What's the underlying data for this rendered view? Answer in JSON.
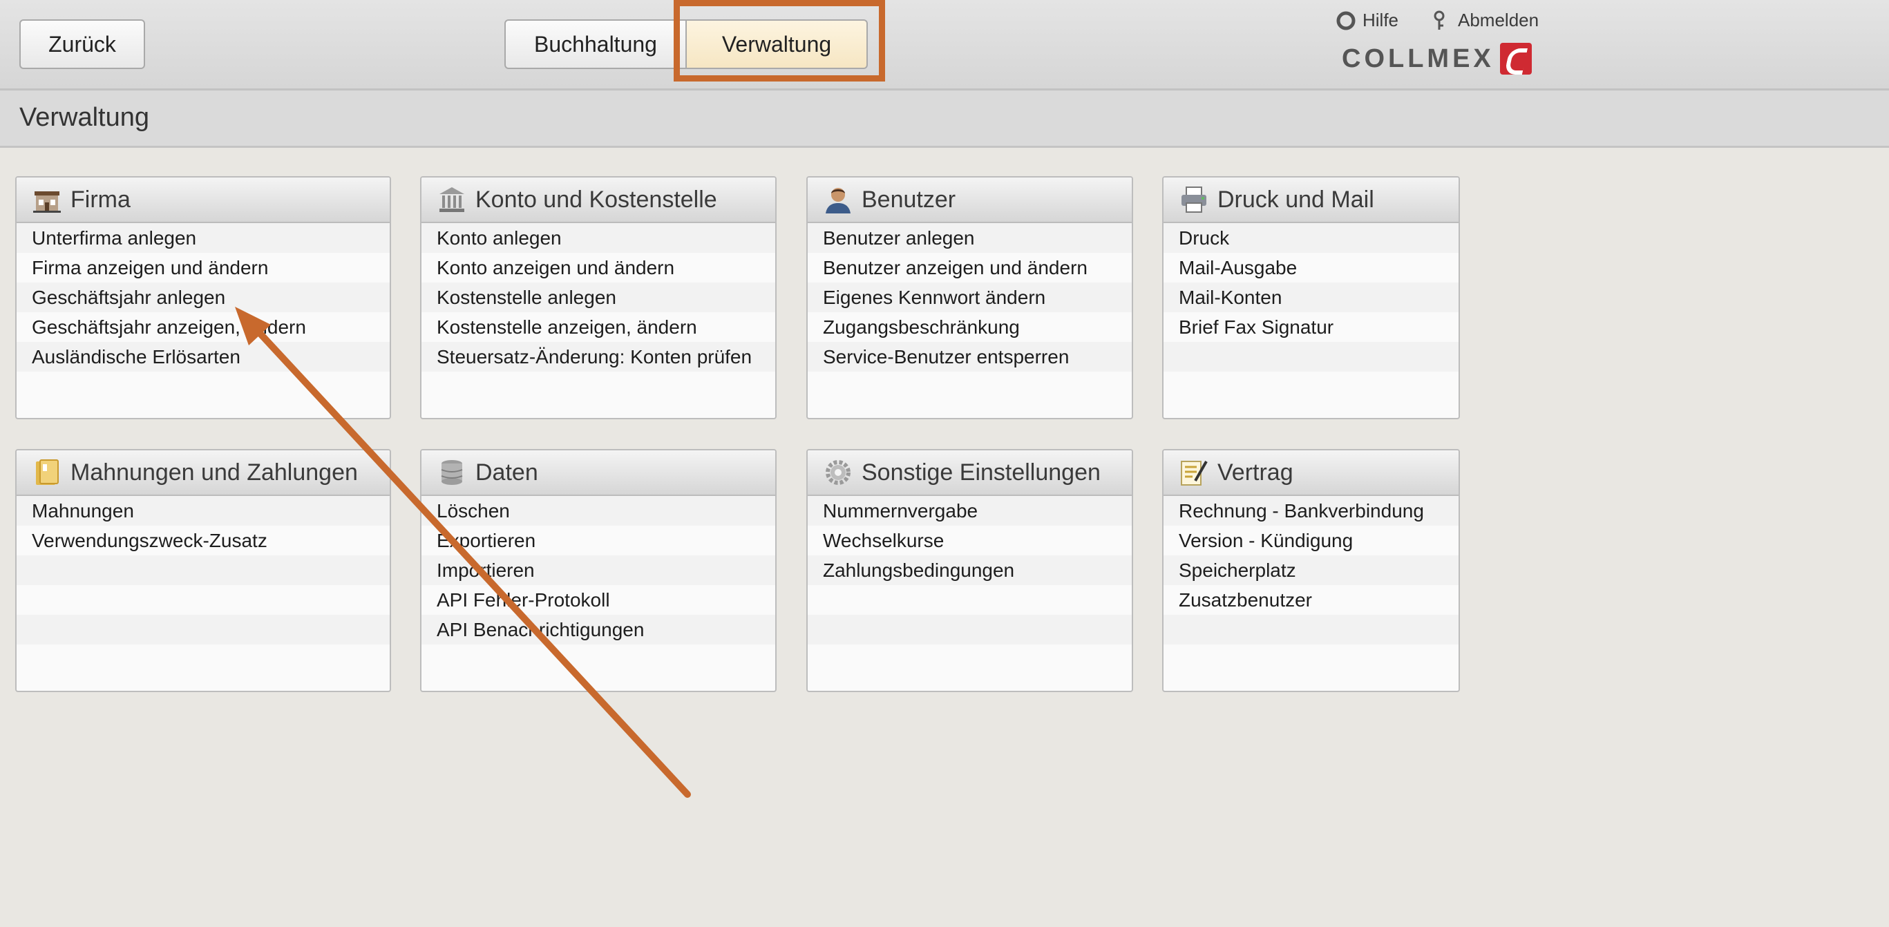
{
  "topbar": {
    "back_label": "Zurück",
    "tabs": [
      {
        "label": "Buchhaltung"
      },
      {
        "label": "Verwaltung"
      }
    ],
    "help_label": "Hilfe",
    "logout_label": "Abmelden",
    "logo_text": "COLLMEX"
  },
  "page_title": "Verwaltung",
  "panels": [
    {
      "title": "Firma",
      "icon": "building-icon",
      "items": [
        "Unterfirma anlegen",
        "Firma anzeigen und ändern",
        "Geschäftsjahr anlegen",
        "Geschäftsjahr anzeigen, ändern",
        "Ausländische Erlösarten"
      ]
    },
    {
      "title": "Konto und Kostenstelle",
      "icon": "bank-icon",
      "items": [
        "Konto anlegen",
        "Konto anzeigen und ändern",
        "Kostenstelle anlegen",
        "Kostenstelle anzeigen, ändern",
        "Steuersatz-Änderung: Konten prüfen"
      ]
    },
    {
      "title": "Benutzer",
      "icon": "user-icon",
      "items": [
        "Benutzer anlegen",
        "Benutzer anzeigen und ändern",
        "Eigenes Kennwort ändern",
        "Zugangsbeschränkung",
        "Service-Benutzer entsperren"
      ]
    },
    {
      "title": "Druck und Mail",
      "icon": "printer-icon",
      "items": [
        "Druck",
        "Mail-Ausgabe",
        "Mail-Konten",
        "Brief Fax Signatur"
      ]
    },
    {
      "title": "Mahnungen und Zahlungen",
      "icon": "folder-icon",
      "items": [
        "Mahnungen",
        "Verwendungszweck-Zusatz"
      ]
    },
    {
      "title": "Daten",
      "icon": "database-icon",
      "items": [
        "Löschen",
        "Exportieren",
        "Importieren",
        "API Fehler-Protokoll",
        "API Benachrichtigungen"
      ]
    },
    {
      "title": "Sonstige Einstellungen",
      "icon": "gear-icon",
      "items": [
        "Nummernvergabe",
        "Wechselkurse",
        "Zahlungsbedingungen"
      ]
    },
    {
      "title": "Vertrag",
      "icon": "contract-icon",
      "items": [
        "Rechnung - Bankverbindung",
        "Version - Kündigung",
        "Speicherplatz",
        "Zusatzbenutzer"
      ]
    }
  ],
  "colors": {
    "highlight": "#c8692d",
    "active_tab": "#f6e6c3",
    "logo_red": "#cf2a32"
  }
}
